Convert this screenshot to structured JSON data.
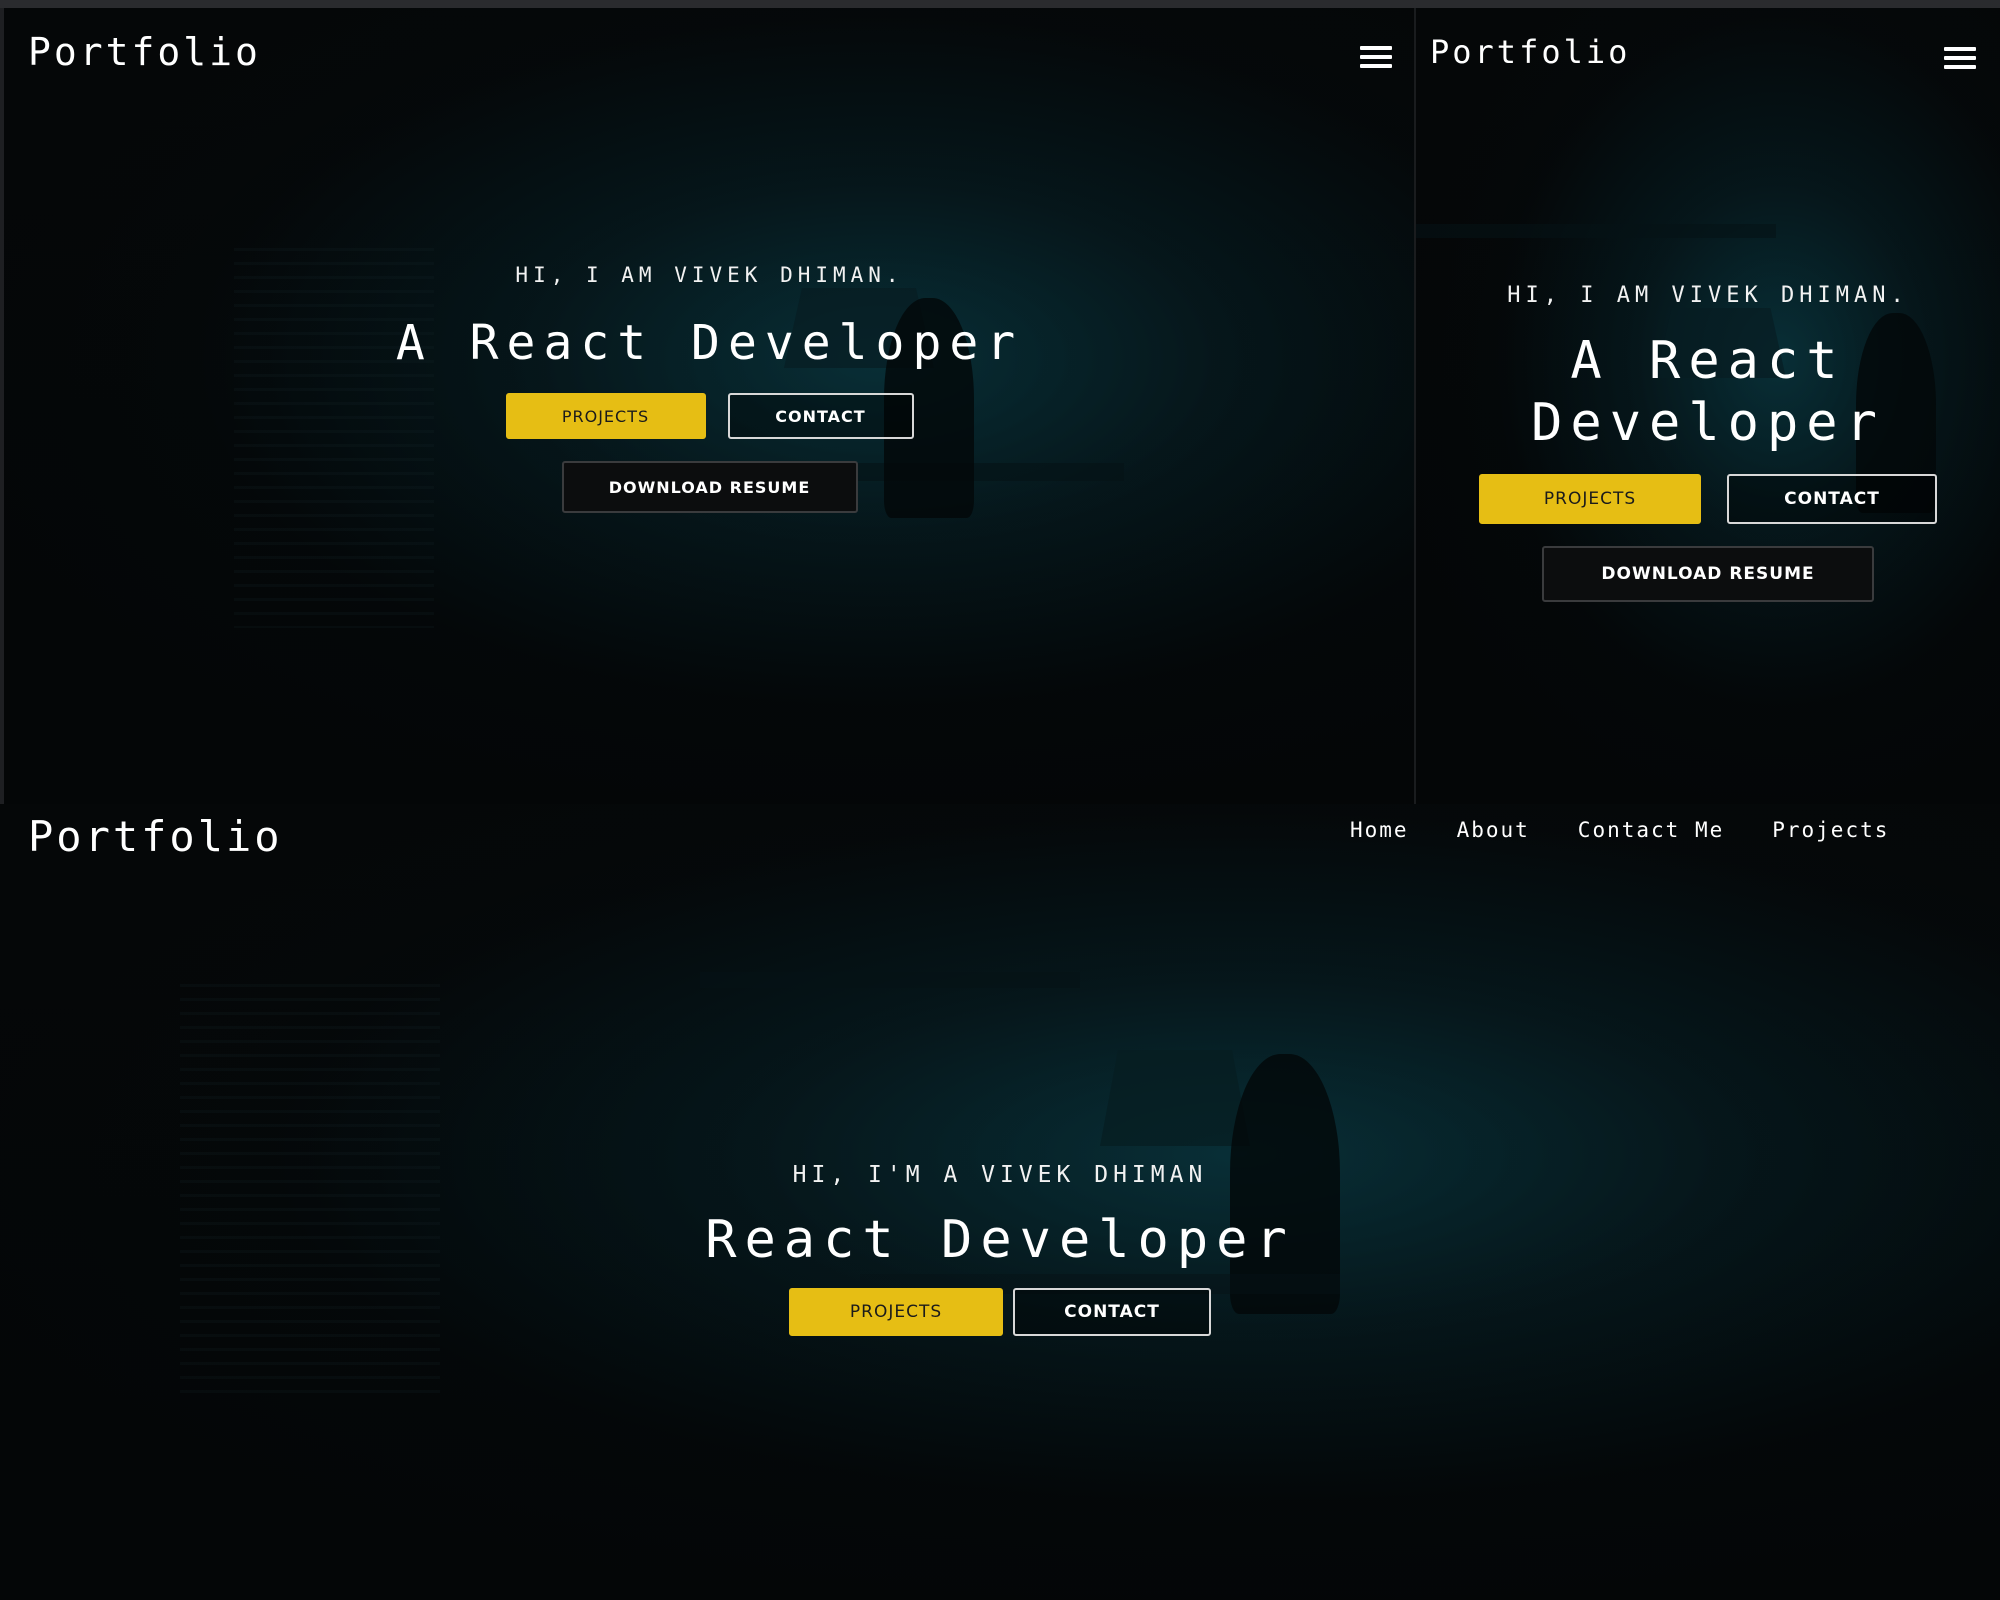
{
  "views": {
    "tablet": {
      "logo": "Portfolio",
      "menu_icon": "hamburger-menu-icon",
      "greeting": "HI, I AM VIVEK DHIMAN.",
      "headline": "A React Developer",
      "buttons": {
        "projects": "PROJECTS",
        "contact": "CONTACT",
        "resume": "DOWNLOAD RESUME"
      }
    },
    "mobile": {
      "logo": "Portfolio",
      "menu_icon": "hamburger-menu-icon",
      "greeting": "HI, I AM VIVEK DHIMAN.",
      "headline_line1": "A React",
      "headline_line2": "Developer",
      "buttons": {
        "projects": "PROJECTS",
        "contact": "CONTACT",
        "resume": "DOWNLOAD RESUME"
      }
    },
    "desktop": {
      "logo": "Portfolio",
      "nav": [
        "Home",
        "About",
        "Contact Me",
        "Projects"
      ],
      "greeting": "HI, I'M A VIVEK DHIMAN",
      "headline": "React Developer",
      "buttons": {
        "projects": "PROJECTS",
        "contact": "CONTACT"
      }
    }
  },
  "colors": {
    "accent": "#e6be14",
    "background": "#030405",
    "teal_glow": "#093a44",
    "text": "#ffffff"
  }
}
